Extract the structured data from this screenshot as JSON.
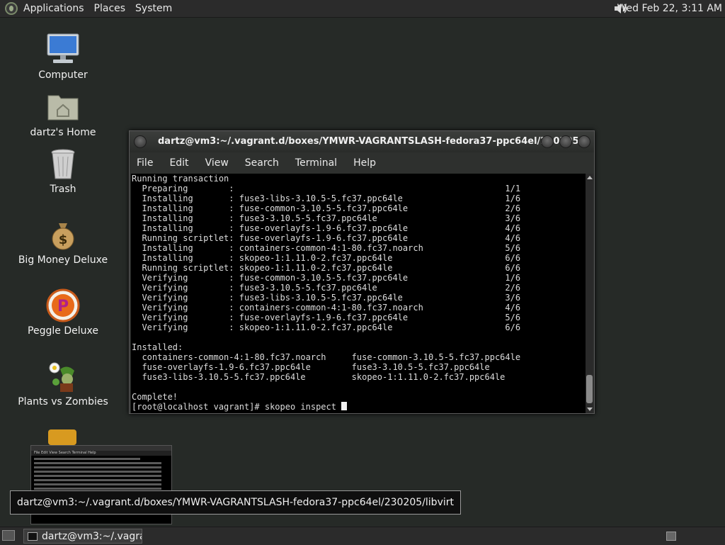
{
  "top_panel": {
    "menus": [
      "Applications",
      "Places",
      "System"
    ],
    "clock": "Wed Feb 22,  3:11 AM"
  },
  "desktop_icons": [
    {
      "label": "Computer",
      "icon": "computer-icon"
    },
    {
      "label": "dartz's Home",
      "icon": "home-folder-icon"
    },
    {
      "label": "Trash",
      "icon": "trash-icon"
    },
    {
      "label": "Big Money Deluxe",
      "icon": "money-bag-icon"
    },
    {
      "label": "Peggle Deluxe",
      "icon": "peggle-icon"
    },
    {
      "label": "Plants vs Zombies",
      "icon": "plants-vs-zombies-icon"
    }
  ],
  "terminal": {
    "title": "dartz@vm3:~/.vagrant.d/boxes/YMWR-VAGRANTSLASH-fedora37-ppc64el/230205...",
    "menu": [
      "File",
      "Edit",
      "View",
      "Search",
      "Terminal",
      "Help"
    ],
    "lines": [
      "Running transaction",
      "  Preparing        :                                                     1/1",
      "  Installing       : fuse3-libs-3.10.5-5.fc37.ppc64le                    1/6",
      "  Installing       : fuse-common-3.10.5-5.fc37.ppc64le                   2/6",
      "  Installing       : fuse3-3.10.5-5.fc37.ppc64le                         3/6",
      "  Installing       : fuse-overlayfs-1.9-6.fc37.ppc64le                   4/6",
      "  Running scriptlet: fuse-overlayfs-1.9-6.fc37.ppc64le                   4/6",
      "  Installing       : containers-common-4:1-80.fc37.noarch                5/6",
      "  Installing       : skopeo-1:1.11.0-2.fc37.ppc64le                      6/6",
      "  Running scriptlet: skopeo-1:1.11.0-2.fc37.ppc64le                      6/6",
      "  Verifying        : fuse-common-3.10.5-5.fc37.ppc64le                   1/6",
      "  Verifying        : fuse3-3.10.5-5.fc37.ppc64le                         2/6",
      "  Verifying        : fuse3-libs-3.10.5-5.fc37.ppc64le                    3/6",
      "  Verifying        : containers-common-4:1-80.fc37.noarch                4/6",
      "  Verifying        : fuse-overlayfs-1.9-6.fc37.ppc64le                   5/6",
      "  Verifying        : skopeo-1:1.11.0-2.fc37.ppc64le                      6/6",
      "",
      "Installed:",
      "  containers-common-4:1-80.fc37.noarch     fuse-common-3.10.5-5.fc37.ppc64le",
      "  fuse-overlayfs-1.9-6.fc37.ppc64le        fuse3-3.10.5-5.fc37.ppc64le",
      "  fuse3-libs-3.10.5-5.fc37.ppc64le         skopeo-1:1.11.0-2.fc37.ppc64le",
      "",
      "Complete!"
    ],
    "prompt": "[root@localhost vagrant]# skopeo inspect "
  },
  "tooltip": "dartz@vm3:~/.vagrant.d/boxes/YMWR-VAGRANTSLASH-fedora37-ppc64el/230205/libvirt",
  "preview_menu": "File  Edit  View  Search  Terminal  Help",
  "taskbar": {
    "task_label": "dartz@vm3:~/.vagra..."
  }
}
